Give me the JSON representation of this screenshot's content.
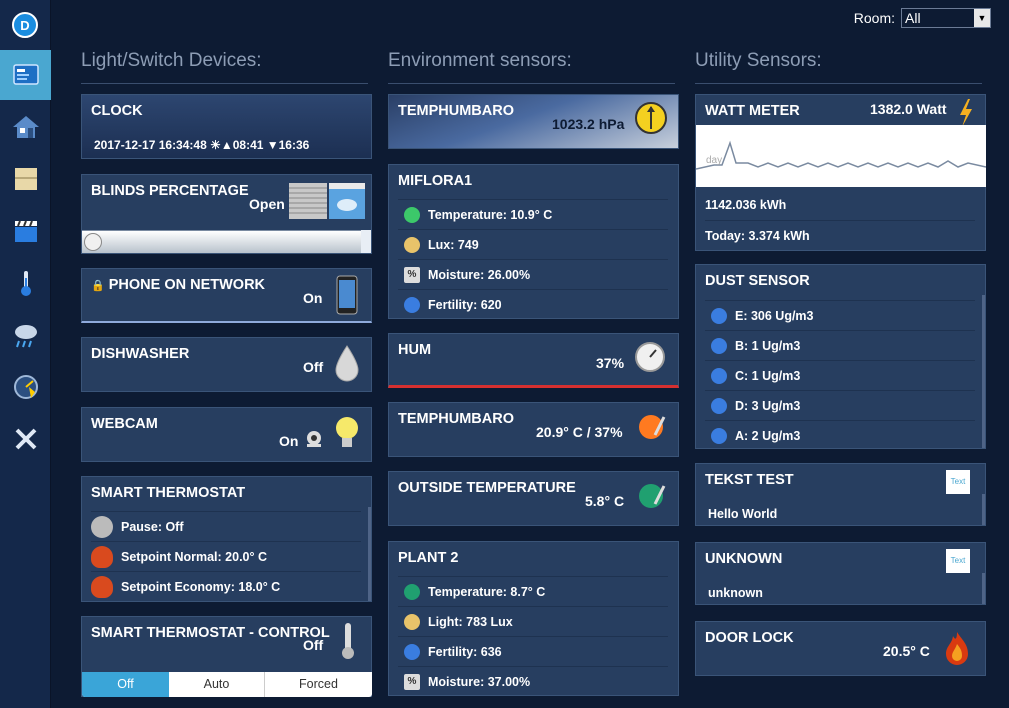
{
  "room": {
    "label": "Room:",
    "value": "All"
  },
  "columns": {
    "lights": "Light/Switch Devices:",
    "env": "Environment sensors:",
    "utility": "Utility Sensors:"
  },
  "lights": {
    "clock": {
      "title": "CLOCK",
      "value": "2017-12-17 16:34:48 ☀▲08:41 ▼16:36"
    },
    "blinds": {
      "title": "BLINDS PERCENTAGE",
      "value": "Open"
    },
    "phone": {
      "title": "PHONE ON NETWORK",
      "value": "On"
    },
    "dishwasher": {
      "title": "DISHWASHER",
      "value": "Off"
    },
    "webcam": {
      "title": "WEBCAM",
      "value": "On"
    },
    "thermostat": {
      "title": "SMART THERMOSTAT",
      "rows": [
        "Pause: Off",
        "Setpoint Normal: 20.0° C",
        "Setpoint Economy: 18.0° C"
      ]
    },
    "thermo_control": {
      "title": "SMART THERMOSTAT - CONTROL",
      "value": "Off",
      "buttons": [
        "Off",
        "Auto",
        "Forced"
      ]
    }
  },
  "env": {
    "temphumbaro1": {
      "title": "TEMPHUMBARO",
      "value": "1023.2 hPa"
    },
    "miflora": {
      "title": "MIFLORA1",
      "rows": [
        "Temperature: 10.9° C",
        "Lux: 749",
        "Moisture: 26.00%",
        "Fertility: 620"
      ]
    },
    "hum": {
      "title": "HUM",
      "value": "37%"
    },
    "temphumbaro2": {
      "title": "TEMPHUMBARO",
      "value": "20.9° C / 37%"
    },
    "outside": {
      "title": "OUTSIDE TEMPERATURE",
      "value": "5.8° C"
    },
    "plant2": {
      "title": "PLANT 2",
      "rows": [
        "Temperature: 8.7° C",
        "Light: 783 Lux",
        "Fertility: 636",
        "Moisture: 37.00%"
      ]
    }
  },
  "utility": {
    "watt": {
      "title": "WATT METER",
      "value": "1382.0 Watt",
      "chart_label": "day",
      "total": "1142.036 kWh",
      "today": "Today: 3.374 kWh"
    },
    "dust": {
      "title": "DUST SENSOR",
      "rows": [
        "E: 306 Ug/m3",
        "B: 1 Ug/m3",
        "C: 1 Ug/m3",
        "D: 3 Ug/m3",
        "A: 2 Ug/m3"
      ]
    },
    "tekst": {
      "title": "TEKST TEST",
      "value": "Hello World",
      "icon_label": "Text"
    },
    "unknown": {
      "title": "UNKNOWN",
      "value": "unknown",
      "icon_label": "Text"
    },
    "door": {
      "title": "DOOR LOCK",
      "value": "20.5° C"
    }
  }
}
